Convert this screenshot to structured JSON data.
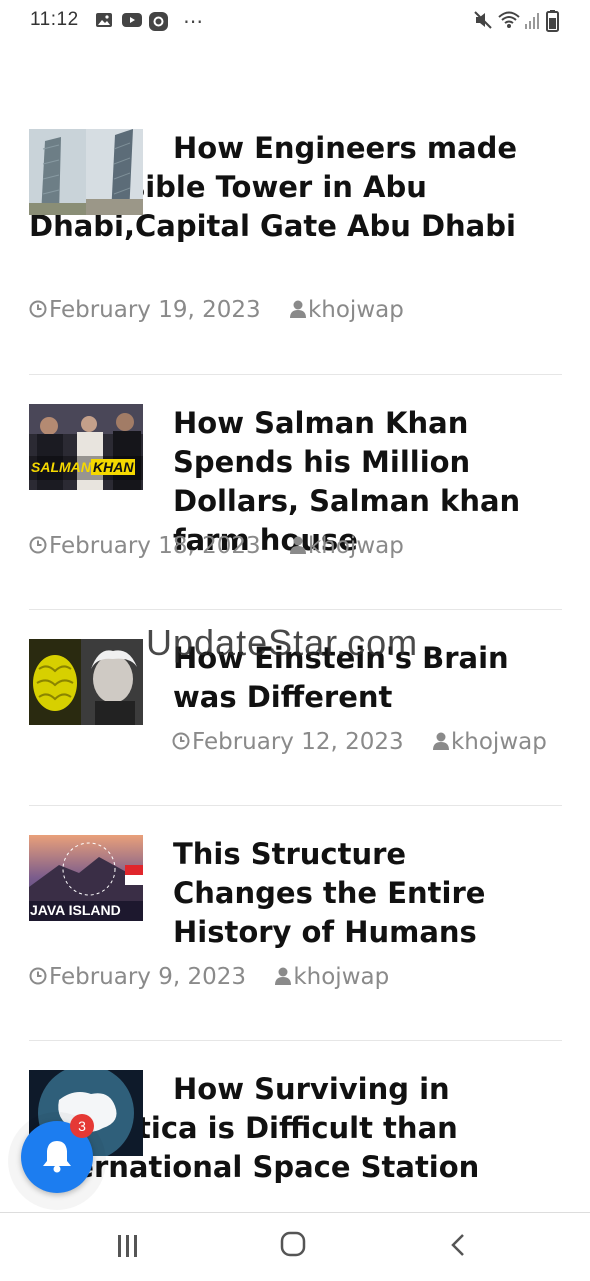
{
  "status_bar": {
    "time": "11:12",
    "left_icons": [
      "gallery-icon",
      "youtube-icon",
      "app-icon",
      "more-dots-icon"
    ],
    "right_icons": [
      "mute-icon",
      "wifi-icon",
      "signal-icon",
      "battery-icon"
    ]
  },
  "watermark": "UpdateStar.com",
  "articles": [
    {
      "title": "How Engineers made Impossible Tower in Abu Dhabi,Capital Gate Abu Dhabi",
      "date": "February 19, 2023",
      "author": "khojwap"
    },
    {
      "title": "How Salman Khan Spends his Million Dollars, Salman khan farm house",
      "date": "February 18, 2023",
      "author": "khojwap",
      "thumb_text_1": "SALMAN",
      "thumb_text_2": "KHAN"
    },
    {
      "title": "How Einstein's Brain was Different",
      "date": "February 12, 2023",
      "author": "khojwap"
    },
    {
      "title": "This Structure Changes the Entire History of Humans",
      "date": "February 9, 2023",
      "author": "khojwap",
      "thumb_text": "JAVA ISLAND"
    },
    {
      "title": "How Surviving in Antarctica is Difficult than International Space Station",
      "date": "",
      "author": ""
    }
  ],
  "notification": {
    "badge_count": "3",
    "accent": "#1c7df0"
  },
  "colors": {
    "meta_text": "#8a8a8a",
    "title_text": "#111111",
    "badge": "#e53935"
  }
}
